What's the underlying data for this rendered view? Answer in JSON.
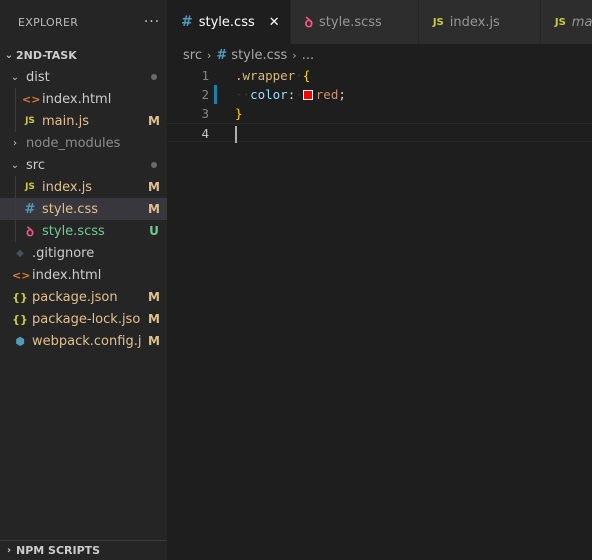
{
  "explorer": {
    "title": "EXPLORER",
    "more": "···",
    "workspace": "2ND-TASK",
    "npm_scripts": "NPM SCRIPTS"
  },
  "tree": {
    "dist": {
      "label": "dist"
    },
    "dist_index": {
      "label": "index.html",
      "icon": "<>"
    },
    "dist_main": {
      "label": "main.js",
      "icon": "JS",
      "status": "M"
    },
    "node_modules": {
      "label": "node_modules"
    },
    "src": {
      "label": "src"
    },
    "src_index": {
      "label": "index.js",
      "icon": "JS",
      "status": "M"
    },
    "src_style_css": {
      "label": "style.css",
      "icon": "#",
      "status": "M"
    },
    "src_style_scss": {
      "label": "style.scss",
      "icon": "ꝺ",
      "status": "U"
    },
    "gitignore": {
      "label": ".gitignore",
      "icon": "◆"
    },
    "index_html": {
      "label": "index.html",
      "icon": "<>"
    },
    "package_json": {
      "label": "package.json",
      "icon": "{}",
      "status": "M"
    },
    "package_lock": {
      "label": "package-lock.json",
      "icon": "{}",
      "status": "M"
    },
    "webpack": {
      "label": "webpack.config.js",
      "icon": "⬢",
      "status": "M"
    }
  },
  "tabs": [
    {
      "label": "style.css",
      "icon": "#",
      "close": "✕"
    },
    {
      "label": "style.scss",
      "icon": "ꝺ"
    },
    {
      "label": "index.js",
      "icon": "JS"
    },
    {
      "label": "main.js",
      "icon": "JS"
    }
  ],
  "breadcrumb": {
    "folder": "src",
    "sep": "›",
    "file": "style.css",
    "more": "..."
  },
  "code": {
    "line_numbers": [
      "1",
      "2",
      "3",
      "4"
    ],
    "selector": ".wrapper",
    "open_brace": "{",
    "property": "color",
    "colon": ":",
    "value": "red",
    "semicolon": ";",
    "close_brace": "}",
    "indent_dots": "··"
  },
  "colors": {
    "modified": "#e2c08d",
    "untracked": "#73c991",
    "css_icon": "#519aba",
    "html_icon": "#e37933",
    "js_icon": "#cbcb41",
    "json_icon": "#cbcb41",
    "webpack_icon": "#519aba",
    "scss_icon": "#f55385",
    "swatch": "#ff0000"
  }
}
